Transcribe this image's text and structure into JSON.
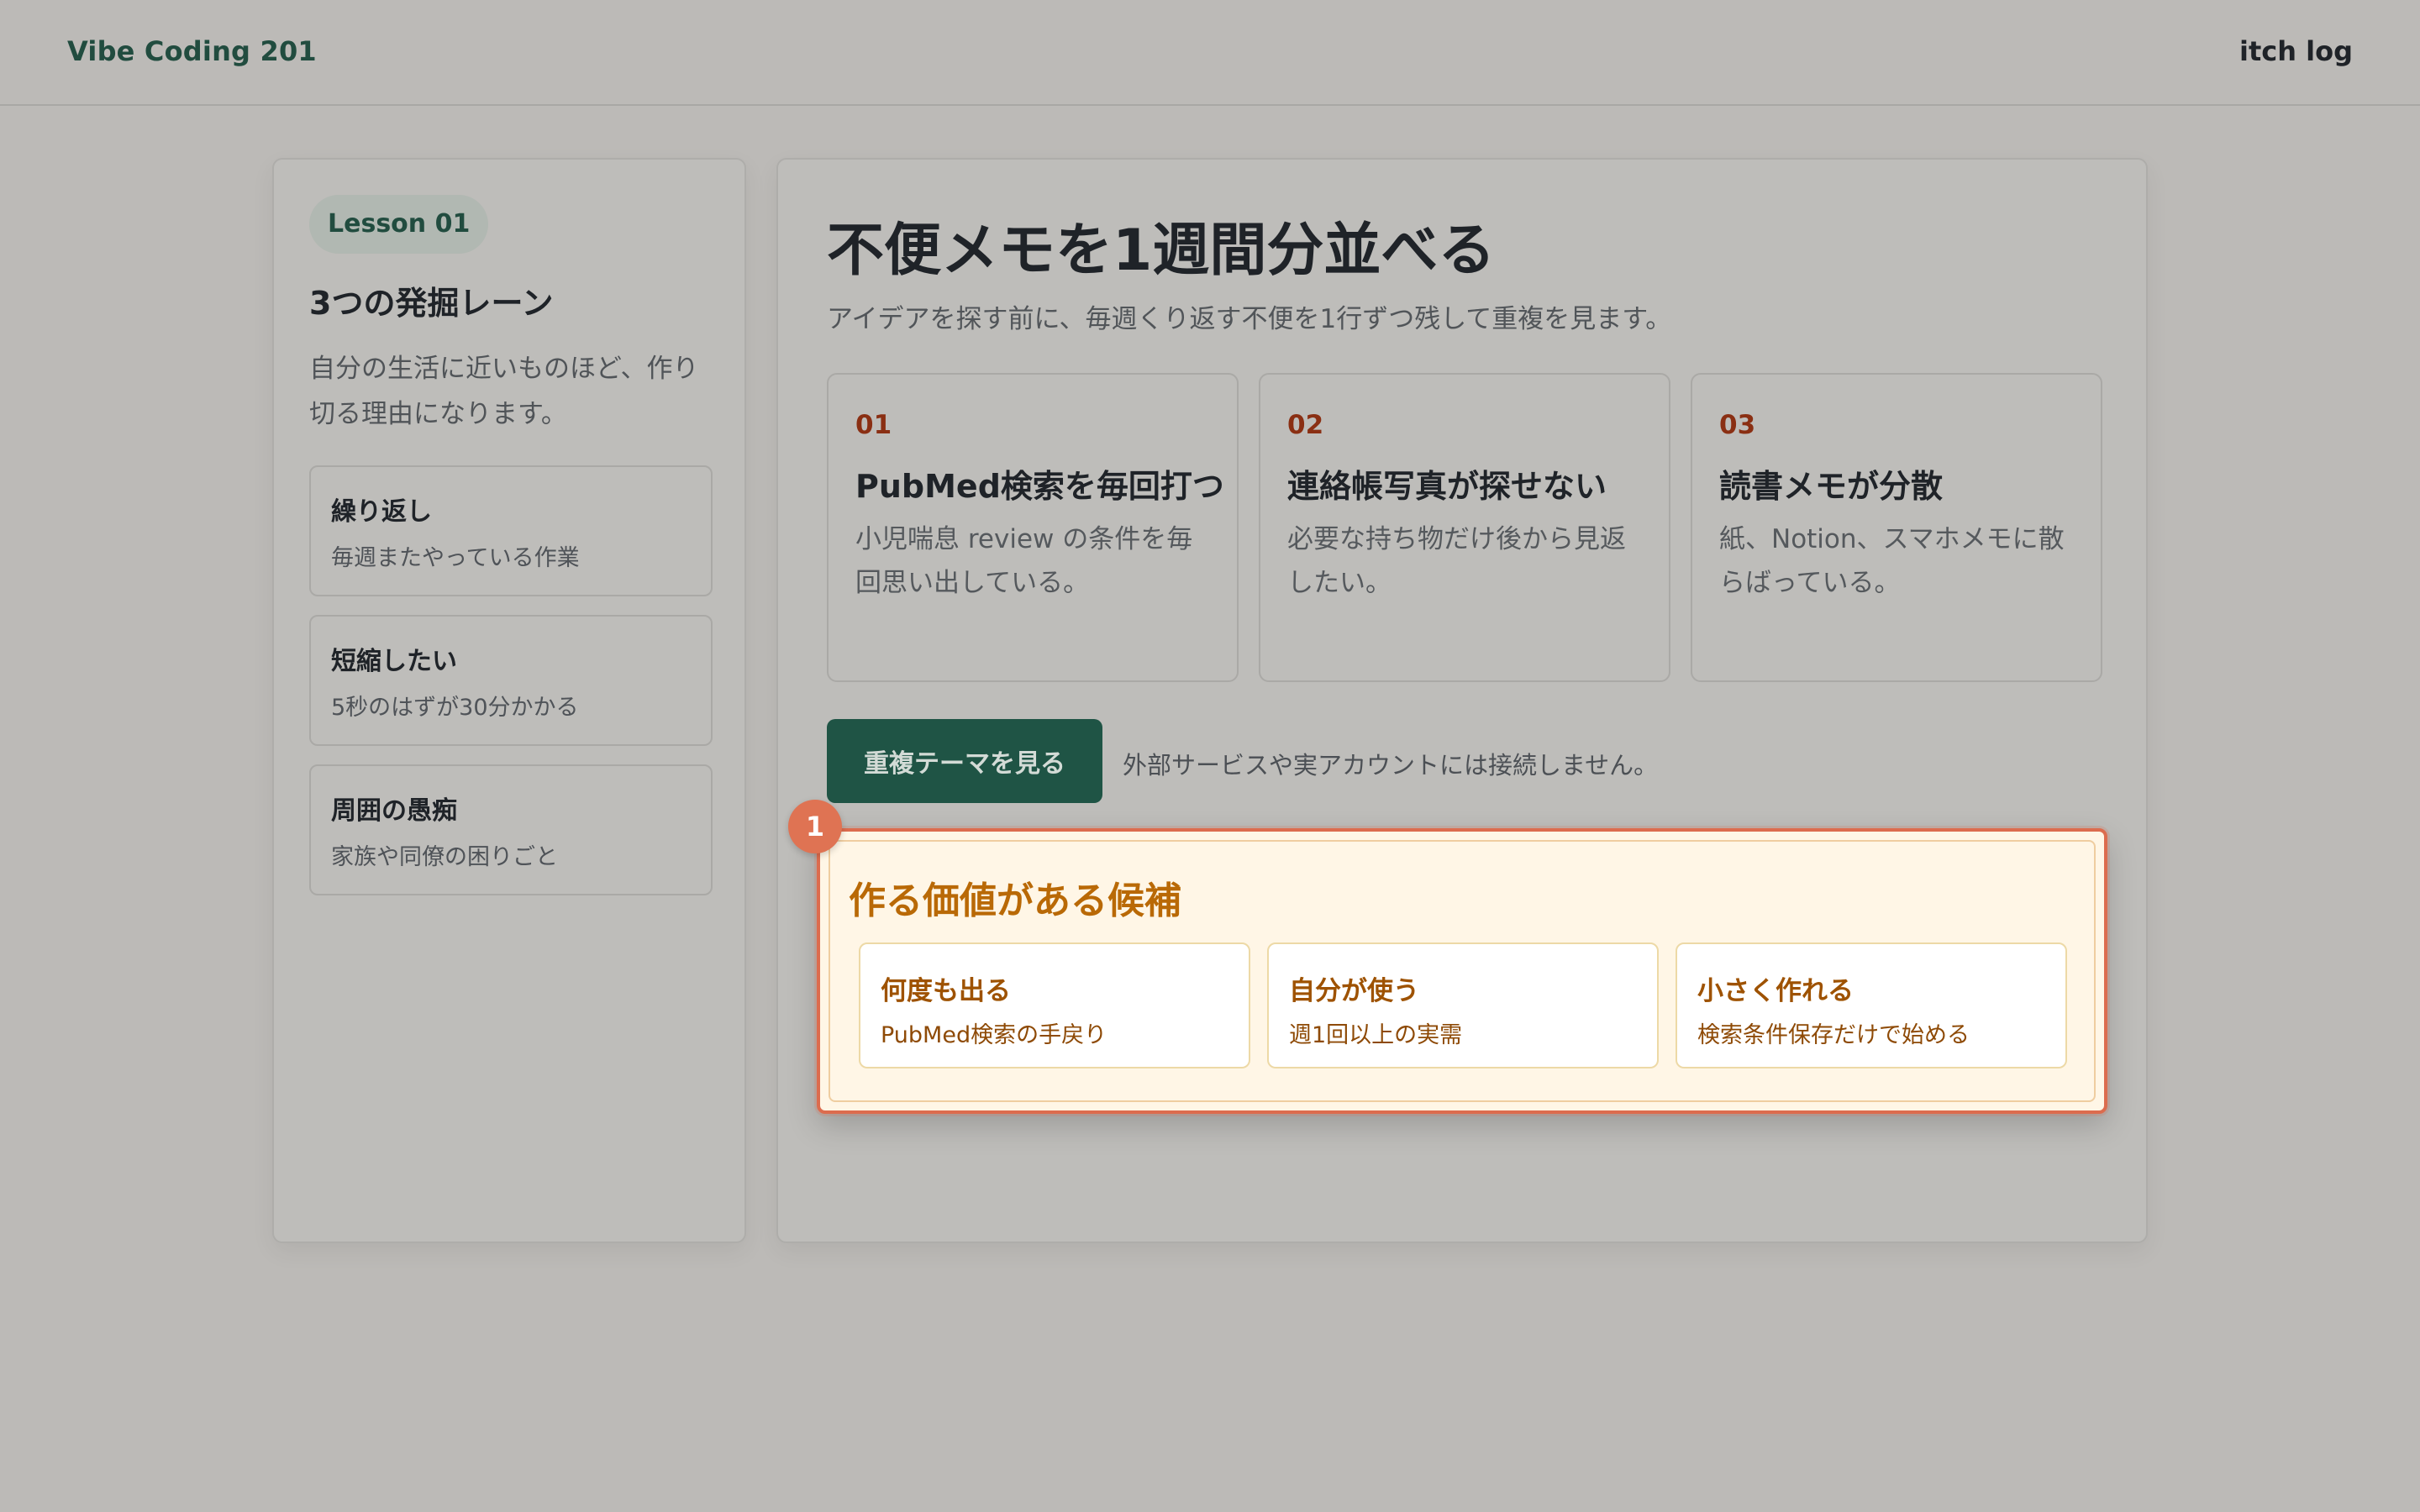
{
  "header": {
    "brand": "Vibe Coding 201",
    "right_link": "itch log"
  },
  "sidebar": {
    "lesson": "Lesson 01",
    "title": "3つの発掘レーン",
    "description": "自分の生活に近いものほど、作り切る理由になります。",
    "lanes": [
      {
        "title": "繰り返し",
        "desc": "毎週またやっている作業"
      },
      {
        "title": "短縮したい",
        "desc": "5秒のはずが30分かかる"
      },
      {
        "title": "周囲の愚痴",
        "desc": "家族や同僚の困りごと"
      }
    ]
  },
  "main": {
    "title": "不便メモを1週間分並べる",
    "subtitle": "アイデアを探す前に、毎週くり返す不便を1行ずつ残して重複を見ます。",
    "cards": [
      {
        "num": "01",
        "title": "PubMed検索を毎回打つ",
        "desc": "小児喘息 review の条件を毎回思い出している。"
      },
      {
        "num": "02",
        "title": "連絡帳写真が探せない",
        "desc": "必要な持ち物だけ後から見返したい。"
      },
      {
        "num": "03",
        "title": "読書メモが分散",
        "desc": "紙、Notion、スマホメモに散らばっている。"
      }
    ],
    "button_label": "重複テーマを見る",
    "note": "外部サービスや実アカウントには接続しません。"
  },
  "callout": {
    "badge": "1",
    "title": "作る価値がある候補",
    "items": [
      {
        "title": "何度も出る",
        "desc": "PubMed検索の手戻り"
      },
      {
        "title": "自分が使う",
        "desc": "週1回以上の実需"
      },
      {
        "title": "小さく作れる",
        "desc": "検索条件保存だけで始める"
      }
    ]
  },
  "colors": {
    "accent": "#1f5445",
    "highlight": "#dc6c4e",
    "callout_bg": "#fff6e6",
    "card_number": "#8a2f13"
  }
}
